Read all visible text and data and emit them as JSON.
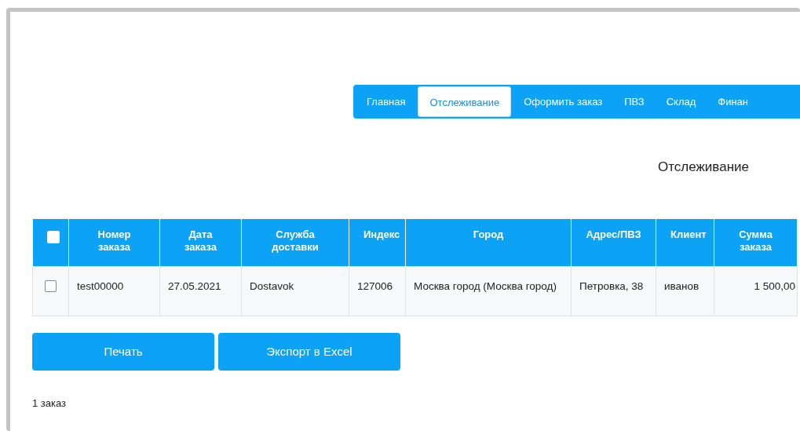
{
  "nav": {
    "tabs": [
      {
        "label": "Главная",
        "selected": false
      },
      {
        "label": "Отслеживание",
        "selected": true
      },
      {
        "label": "Оформить заказ",
        "selected": false
      },
      {
        "label": "ПВЗ",
        "selected": false
      },
      {
        "label": "Склад",
        "selected": false
      },
      {
        "label": "Финан",
        "selected": false
      }
    ]
  },
  "heading": "Отслеживание",
  "table": {
    "select_all": {
      "checked": false
    },
    "columns": [
      "Номер заказа",
      "Дата заказа",
      "Служба доставки",
      "Индекс",
      "Город",
      "Адрес/ПВЗ",
      "Клиент",
      "Сумма заказа"
    ],
    "rows": [
      {
        "checked": false,
        "cells": [
          "test00000",
          "27.05.2021",
          "Dostavok",
          "127006",
          "Москва город (Москва город)",
          "Петровка, 38",
          "иванов",
          "1 500,00"
        ]
      }
    ]
  },
  "buttons": [
    "Печать",
    "Экспорт в Excel"
  ],
  "footer": "1 заказ"
}
